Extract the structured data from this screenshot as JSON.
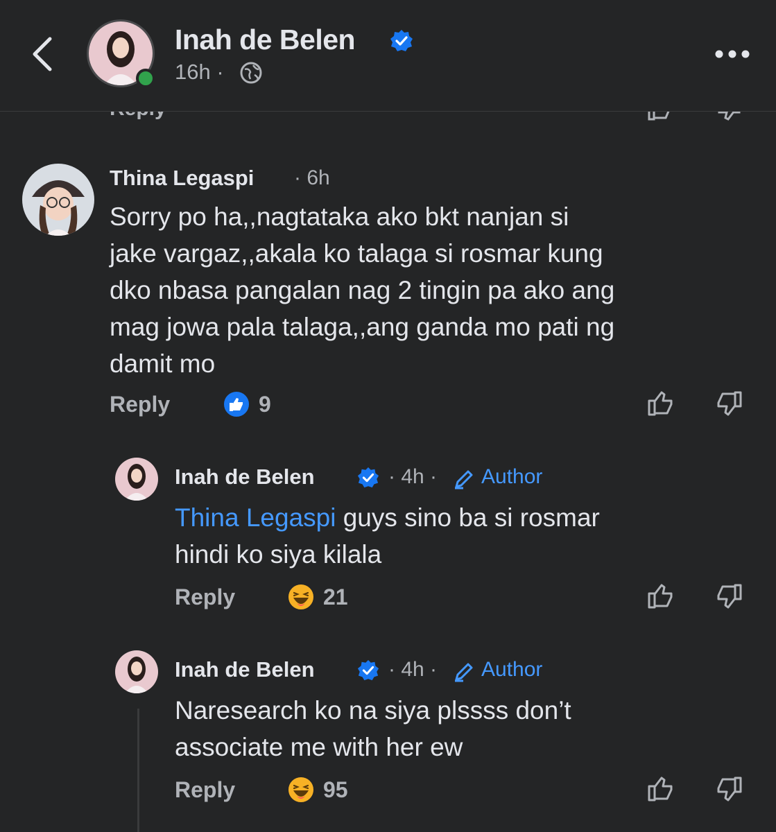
{
  "header": {
    "page_name": "Inah de Belen",
    "time": "16h",
    "separator": "·"
  },
  "ghost_row": {
    "reply_label": "Reply"
  },
  "comments": [
    {
      "author": "Thina Legaspi",
      "time": "· 6h",
      "lines": [
        "Sorry po ha,,nagtataka ako bkt nanjan si",
        "jake vargaz,,akala ko talaga si rosmar kung",
        "dko nbasa pangalan nag 2 tingin pa ako ang",
        "mag jowa pala talaga,,ang ganda mo pati ng",
        "damit mo"
      ],
      "reply_label": "Reply",
      "reaction": "like",
      "reaction_count": "9"
    },
    {
      "author": "Inah de Belen",
      "time": "· 4h ·",
      "author_tag": "Author",
      "mention": "Thina Legaspi",
      "lines": [
        " guys sino ba si rosmar",
        "hindi ko siya kilala"
      ],
      "reply_label": "Reply",
      "reaction": "haha",
      "reaction_count": "21"
    },
    {
      "author": "Inah de Belen",
      "time": "· 4h ·",
      "author_tag": "Author",
      "lines": [
        "Naresearch ko na siya plssss don’t",
        "associate me with her ew"
      ],
      "reply_label": "Reply",
      "reaction": "haha",
      "reaction_count": "95"
    }
  ],
  "colors": {
    "background": "#242526",
    "text": "#e4e6eb",
    "secondary": "#b0b3b8",
    "link": "#4599ff",
    "verified": "#1877f2",
    "online": "#31a24c"
  }
}
